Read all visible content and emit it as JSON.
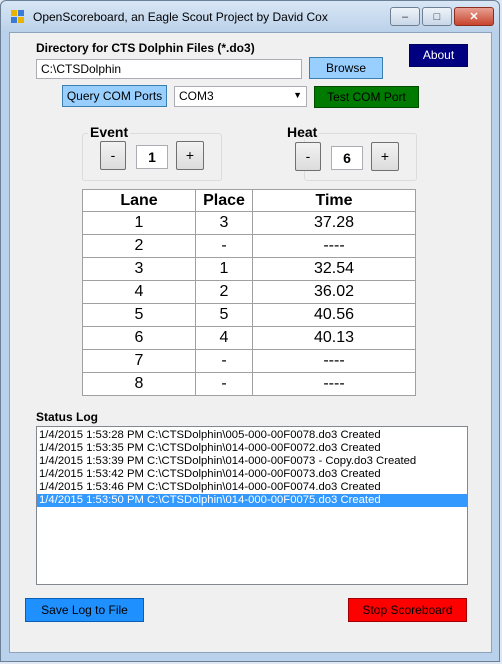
{
  "window": {
    "title": "OpenScoreboard, an Eagle Scout Project by David Cox",
    "minimize": "–",
    "maximize": "□",
    "close": "✕"
  },
  "directory": {
    "label": "Directory for CTS Dolphin Files (*.do3)",
    "value": "C:\\CTSDolphin",
    "browse_label": "Browse"
  },
  "about_label": "About",
  "com": {
    "query_label": "Query COM Ports",
    "selected_port": "COM3",
    "test_label": "Test COM Port"
  },
  "event": {
    "label": "Event",
    "minus": "-",
    "plus": "+",
    "value": "1"
  },
  "heat": {
    "label": "Heat",
    "minus": "-",
    "plus": "+",
    "value": "6"
  },
  "results": {
    "headers": [
      "Lane",
      "Place",
      "Time"
    ],
    "rows": [
      [
        "1",
        "3",
        "37.28"
      ],
      [
        "2",
        "-",
        "----"
      ],
      [
        "3",
        "1",
        "32.54"
      ],
      [
        "4",
        "2",
        "36.02"
      ],
      [
        "5",
        "5",
        "40.56"
      ],
      [
        "6",
        "4",
        "40.13"
      ],
      [
        "7",
        "-",
        "----"
      ],
      [
        "8",
        "-",
        "----"
      ]
    ]
  },
  "status_log": {
    "label": "Status Log",
    "lines": [
      "1/4/2015 1:53:28 PM C:\\CTSDolphin\\005-000-00F0078.do3 Created",
      "1/4/2015 1:53:35 PM C:\\CTSDolphin\\014-000-00F0072.do3 Created",
      "1/4/2015 1:53:39 PM C:\\CTSDolphin\\014-000-00F0073 - Copy.do3 Created",
      "1/4/2015 1:53:42 PM C:\\CTSDolphin\\014-000-00F0073.do3 Created",
      "1/4/2015 1:53:46 PM C:\\CTSDolphin\\014-000-00F0074.do3 Created",
      "1/4/2015 1:53:50 PM C:\\CTSDolphin\\014-000-00F0075.do3 Created"
    ],
    "selected_index": 5
  },
  "save_log_label": "Save Log to File",
  "stop_label": "Stop Scoreboard"
}
